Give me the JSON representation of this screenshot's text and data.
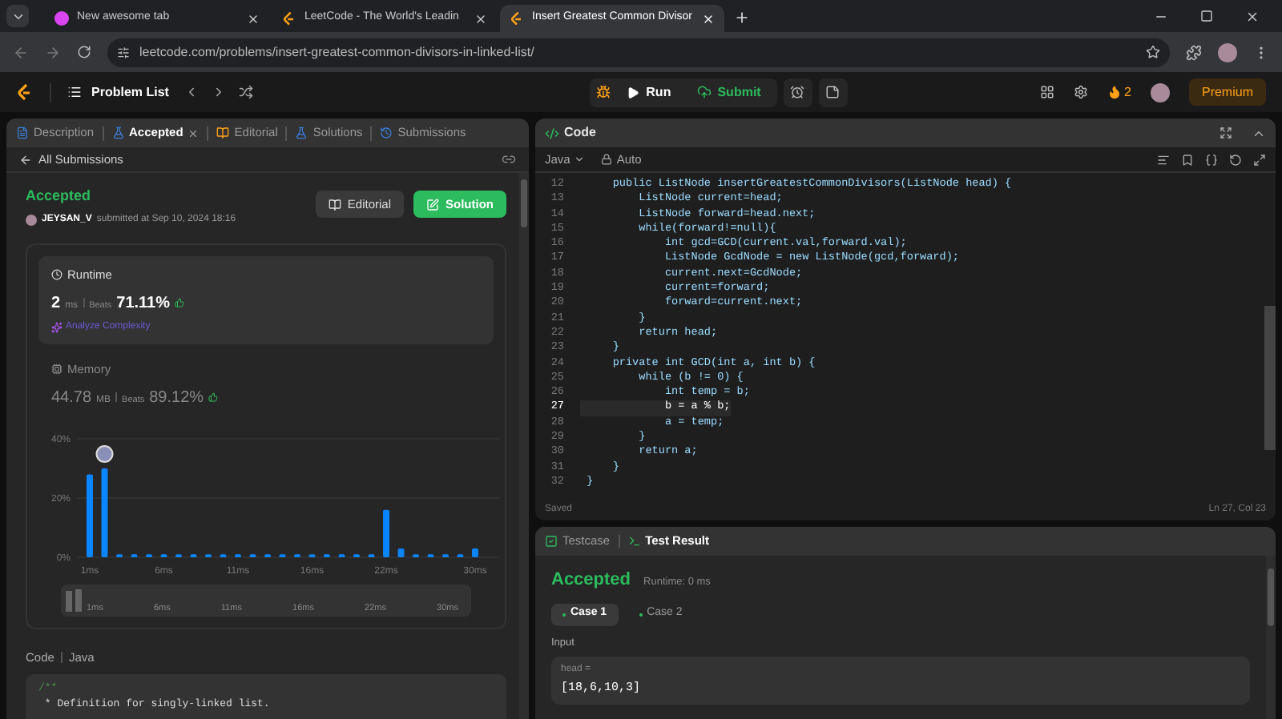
{
  "browser": {
    "tabs": [
      {
        "title": "New awesome tab",
        "selected": false,
        "kind": "pink"
      },
      {
        "title": "LeetCode - The World's Leadin",
        "selected": false,
        "kind": "leetcode"
      },
      {
        "title": "Insert Greatest Common Divisor",
        "selected": true,
        "kind": "leetcode"
      }
    ],
    "url": "leetcode.com/problems/insert-greatest-common-divisors-in-linked-list/"
  },
  "navbar": {
    "problem_list": "Problem List",
    "run": "Run",
    "submit": "Submit",
    "streak": "2",
    "premium": "Premium"
  },
  "left_panel": {
    "tabs": [
      {
        "label": "Description",
        "selected": false,
        "closable": false
      },
      {
        "label": "Accepted",
        "selected": true,
        "closable": true
      },
      {
        "label": "Editorial",
        "selected": false,
        "closable": false
      },
      {
        "label": "Solutions",
        "selected": false,
        "closable": false
      },
      {
        "label": "Submissions",
        "selected": false,
        "closable": false
      }
    ],
    "back_link": "All Submissions",
    "status": "Accepted",
    "user": "JEYSAN_V",
    "submitted": "submitted at Sep 10, 2024 18:16",
    "buttons": [
      "Editorial",
      "Solution"
    ],
    "runtime": {
      "title": "Runtime",
      "value": "2",
      "unit": "ms",
      "beats_label": "Beats",
      "beats": "71.11%",
      "analyze": "Analyze Complexity"
    },
    "memory": {
      "title": "Memory",
      "value": "44.78",
      "unit": "MB",
      "beats_label": "Beats",
      "beats": "89.12%"
    },
    "chart_data": {
      "type": "bar",
      "categories": [
        "1ms",
        null,
        null,
        null,
        null,
        "6ms",
        null,
        null,
        null,
        null,
        "11ms",
        null,
        null,
        null,
        null,
        "16ms",
        null,
        null,
        null,
        null,
        "22ms",
        null,
        null,
        null,
        null,
        null,
        "30ms"
      ],
      "yticks": [
        {
          "value": 0,
          "label": "0%"
        },
        {
          "value": 20,
          "label": "20%"
        },
        {
          "value": 40,
          "label": "40%"
        }
      ],
      "ylim": [
        0,
        40
      ],
      "series": [
        {
          "color": "#0a84ff",
          "values": [
            28,
            30,
            1,
            1,
            1,
            1,
            1,
            1,
            1,
            1,
            1,
            1,
            1,
            1,
            1,
            1,
            1,
            1,
            1,
            1,
            16,
            3,
            1,
            1,
            1,
            1,
            3
          ]
        }
      ]
    },
    "navigator_labels": [
      "1ms",
      "6ms",
      "11ms",
      "16ms",
      "22ms",
      "30ms"
    ],
    "code_header": [
      "Code",
      "Java"
    ],
    "code_lines": [
      "/**",
      " * Definition for singly-linked list."
    ]
  },
  "editor": {
    "title": "Code",
    "language": "Java",
    "mode": "Auto",
    "lines": [
      {
        "n": "12",
        "text": "    public ListNode insertGreatestCommonDivisors(ListNode head) {",
        "selected": false
      },
      {
        "n": "13",
        "text": "        ListNode current=head;",
        "selected": false
      },
      {
        "n": "14",
        "text": "        ListNode forward=head.next;",
        "selected": false
      },
      {
        "n": "15",
        "text": "        while(forward!=null){",
        "selected": false
      },
      {
        "n": "16",
        "text": "            int gcd=GCD(current.val,forward.val);",
        "selected": false
      },
      {
        "n": "17",
        "text": "            ListNode GcdNode = new ListNode(gcd,forward);",
        "selected": false
      },
      {
        "n": "18",
        "text": "            current.next=GcdNode;",
        "selected": false
      },
      {
        "n": "19",
        "text": "            current=forward;",
        "selected": false
      },
      {
        "n": "20",
        "text": "            forward=current.next;",
        "selected": false
      },
      {
        "n": "21",
        "text": "        }",
        "selected": false
      },
      {
        "n": "22",
        "text": "        return head;",
        "selected": false
      },
      {
        "n": "23",
        "text": "    }",
        "selected": false
      },
      {
        "n": "24",
        "text": "    private int GCD(int a, int b) {",
        "selected": false
      },
      {
        "n": "25",
        "text": "        while (b != 0) {",
        "selected": false
      },
      {
        "n": "26",
        "text": "            int temp = b;",
        "selected": false
      },
      {
        "n": "27",
        "text": "            b = a % b;",
        "selected": true
      },
      {
        "n": "28",
        "text": "            a = temp;",
        "selected": false
      },
      {
        "n": "29",
        "text": "        }",
        "selected": false
      },
      {
        "n": "30",
        "text": "        return a;",
        "selected": false
      },
      {
        "n": "31",
        "text": "    }",
        "selected": false
      },
      {
        "n": "32",
        "text": "}",
        "selected": false
      }
    ],
    "saved": "Saved",
    "cursor": "Ln 27, Col 23"
  },
  "result_panel": {
    "tabs": [
      {
        "label": "Testcase",
        "selected": false
      },
      {
        "label": "Test Result",
        "selected": true
      }
    ],
    "status": "Accepted",
    "runtime": "Runtime: 0 ms",
    "cases": [
      {
        "label": "Case 1",
        "selected": true
      },
      {
        "label": "Case 2",
        "selected": false
      }
    ],
    "input_label": "Input",
    "var_name": "head =",
    "var_value": "[18,6,10,3]"
  }
}
